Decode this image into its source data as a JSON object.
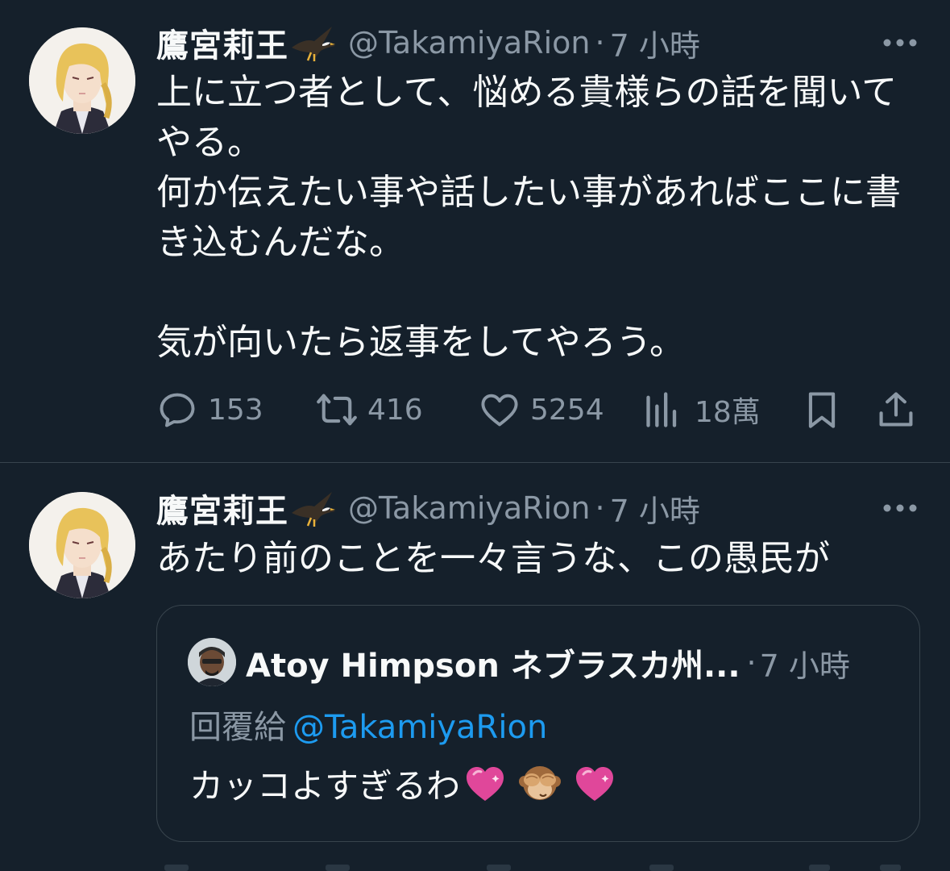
{
  "colors": {
    "background": "#15202b",
    "text": "#f7f9f9",
    "muted": "#8b98a5",
    "link": "#1d9bf0",
    "border": "#38444d",
    "heart_emoji": "#e0479a"
  },
  "tweets": [
    {
      "author": {
        "display_name": "鷹宮莉王",
        "name_emoji": "eagle-icon",
        "handle": "@TakamiyaRion",
        "separator": "·",
        "time": "7 小時"
      },
      "text": "上に立つ者として、悩める貴様らの話を聞いてやる。\n何か伝えたい事や話したい事があればここに書き込むんだな。\n\n気が向いたら返事をしてやろう。",
      "actions": {
        "replies": "153",
        "retweets": "416",
        "likes": "5254",
        "views": "18萬"
      }
    },
    {
      "author": {
        "display_name": "鷹宮莉王",
        "name_emoji": "eagle-icon",
        "handle": "@TakamiyaRion",
        "separator": "·",
        "time": "7 小時"
      },
      "text": "あたり前のことを一々言うな、この愚民が",
      "quote": {
        "name": "Atoy Himpson ネブラスカ州...",
        "separator": "·",
        "time": "7 小時",
        "reply_prefix": "回覆給",
        "reply_to": "@TakamiyaRion",
        "text": "カッコよすぎるわ",
        "emojis": [
          "pink-heart-icon",
          "see-no-evil-monkey-icon",
          "pink-heart-icon"
        ]
      }
    }
  ]
}
